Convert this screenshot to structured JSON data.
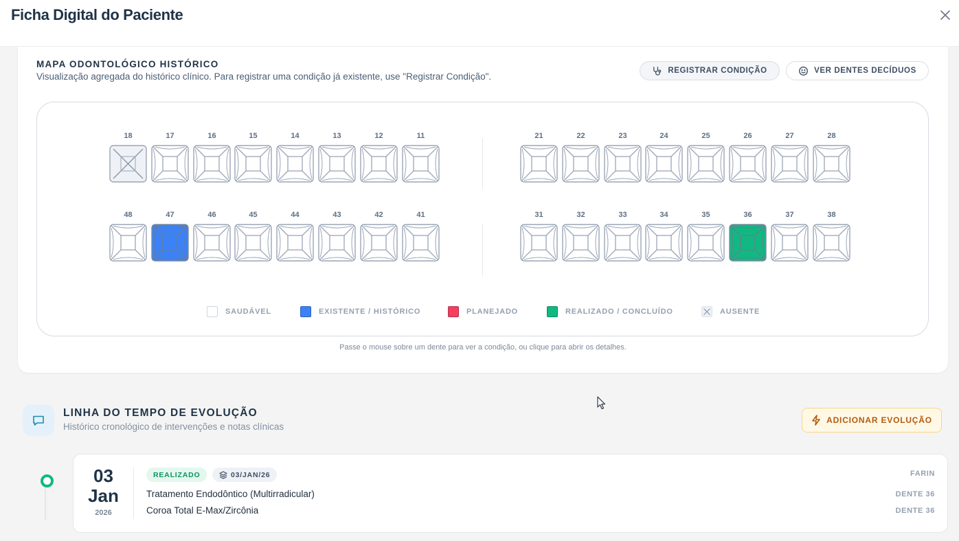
{
  "header": {
    "title": "Ficha Digital do Paciente"
  },
  "map": {
    "title": "MAPA ODONTOLÓGICO HISTÓRICO",
    "subtitle": "Visualização agregada do histórico clínico. Para registrar uma condição já existente, use \"Registrar Condição\".",
    "register_label": "REGISTRAR CONDIÇÃO",
    "deciduous_label": "VER DENTES DECÍDUOS",
    "upper_right": [
      {
        "number": "18",
        "status": "ausente"
      },
      {
        "number": "17",
        "status": "saudavel"
      },
      {
        "number": "16",
        "status": "saudavel"
      },
      {
        "number": "15",
        "status": "saudavel"
      },
      {
        "number": "14",
        "status": "saudavel"
      },
      {
        "number": "13",
        "status": "saudavel"
      },
      {
        "number": "12",
        "status": "saudavel"
      },
      {
        "number": "11",
        "status": "saudavel"
      }
    ],
    "upper_left": [
      {
        "number": "21",
        "status": "saudavel"
      },
      {
        "number": "22",
        "status": "saudavel"
      },
      {
        "number": "23",
        "status": "saudavel"
      },
      {
        "number": "24",
        "status": "saudavel"
      },
      {
        "number": "25",
        "status": "saudavel"
      },
      {
        "number": "26",
        "status": "saudavel"
      },
      {
        "number": "27",
        "status": "saudavel"
      },
      {
        "number": "28",
        "status": "saudavel"
      }
    ],
    "lower_right": [
      {
        "number": "48",
        "status": "saudavel"
      },
      {
        "number": "47",
        "status": "existente"
      },
      {
        "number": "46",
        "status": "saudavel"
      },
      {
        "number": "45",
        "status": "saudavel"
      },
      {
        "number": "44",
        "status": "saudavel"
      },
      {
        "number": "43",
        "status": "saudavel"
      },
      {
        "number": "42",
        "status": "saudavel"
      },
      {
        "number": "41",
        "status": "saudavel"
      }
    ],
    "lower_left": [
      {
        "number": "31",
        "status": "saudavel"
      },
      {
        "number": "32",
        "status": "saudavel"
      },
      {
        "number": "33",
        "status": "saudavel"
      },
      {
        "number": "34",
        "status": "saudavel"
      },
      {
        "number": "35",
        "status": "saudavel"
      },
      {
        "number": "36",
        "status": "realizado"
      },
      {
        "number": "37",
        "status": "saudavel"
      },
      {
        "number": "38",
        "status": "saudavel"
      }
    ],
    "legend": [
      {
        "key": "saudavel",
        "label": "SAUDÁVEL",
        "color": "#ffffff"
      },
      {
        "key": "existente",
        "label": "EXISTENTE / HISTÓRICO",
        "color": "#3b82f6"
      },
      {
        "key": "planejado",
        "label": "PLANEJADO",
        "color": "#f43f5e"
      },
      {
        "key": "realizado",
        "label": "REALIZADO / CONCLUÍDO",
        "color": "#10b981"
      },
      {
        "key": "ausente",
        "label": "AUSENTE",
        "color": "#eef1f6"
      }
    ],
    "hint": "Passe o mouse sobre um dente para ver a condição, ou clique para abrir os detalhes."
  },
  "timeline": {
    "title": "LINHA DO TEMPO DE EVOLUÇÃO",
    "subtitle": "Histórico cronológico de intervenções e notas clínicas",
    "add_label": "ADICIONAR EVOLUÇÃO",
    "entries": [
      {
        "day": "03",
        "month": "Jan",
        "year": "2026",
        "status": "REALIZADO",
        "date_badge": "03/JAN/26",
        "professional": "FARIN",
        "procedures": [
          {
            "name": "Tratamento Endodôntico (Multirradicular)",
            "tooth": "DENTE 36"
          },
          {
            "name": "Coroa Total E-Max/Zircônia",
            "tooth": "DENTE 36"
          }
        ]
      }
    ]
  }
}
